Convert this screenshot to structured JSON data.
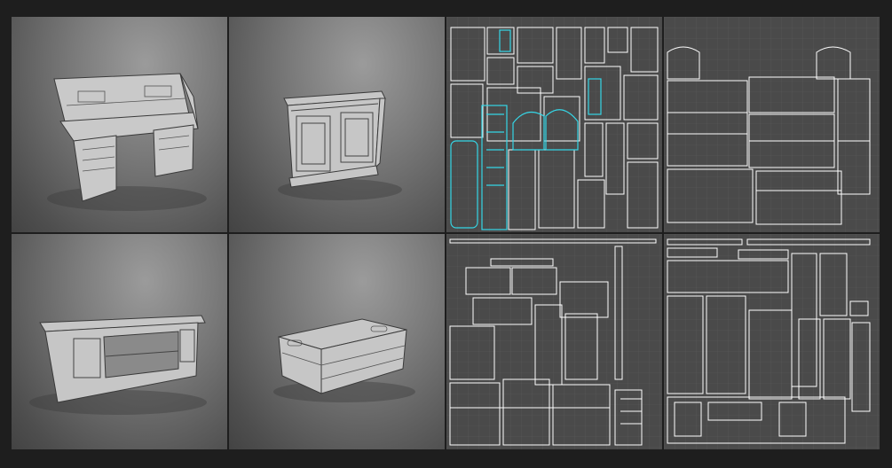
{
  "gallery": {
    "renders": [
      {
        "name": "desk",
        "icon": "desk-wireframe-icon"
      },
      {
        "name": "cabinet",
        "icon": "cabinet-wireframe-icon"
      },
      {
        "name": "tv-stand",
        "icon": "tv-stand-wireframe-icon"
      },
      {
        "name": "crate",
        "icon": "crate-wireframe-icon"
      }
    ],
    "uv_maps": [
      {
        "name": "uv-map-desk",
        "highlight": "#35d6e6"
      },
      {
        "name": "uv-map-cabinet",
        "highlight": ""
      },
      {
        "name": "uv-map-tv-stand",
        "highlight": ""
      },
      {
        "name": "uv-map-crate",
        "highlight": ""
      }
    ]
  },
  "colors": {
    "background": "#1e1e1e",
    "uv_panel": "#4a4a4a",
    "uv_line": "#ffffff",
    "uv_selected": "#35d6e6"
  }
}
